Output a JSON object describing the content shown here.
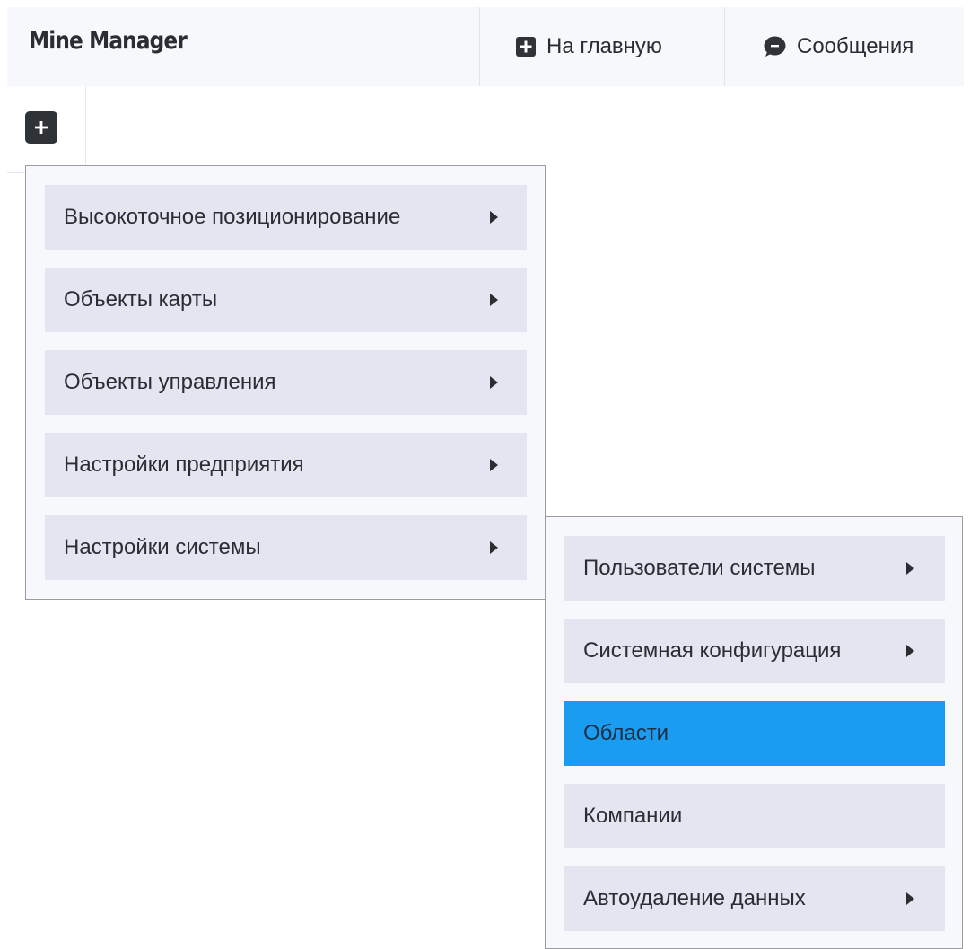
{
  "header": {
    "app_title": "Mine Manager",
    "nav": {
      "home_label": "На главную",
      "messages_label": "Сообщения"
    }
  },
  "sidebar": {
    "add_button_icon": "plus-square-icon"
  },
  "menu": {
    "items": [
      {
        "label": "Высокоточное позиционирование",
        "has_submenu": true
      },
      {
        "label": "Объекты карты",
        "has_submenu": true
      },
      {
        "label": "Объекты управления",
        "has_submenu": true
      },
      {
        "label": "Настройки предприятия",
        "has_submenu": true
      },
      {
        "label": "Настройки системы",
        "has_submenu": true,
        "expanded": true
      }
    ]
  },
  "submenu": {
    "items": [
      {
        "label": "Пользователи системы",
        "has_submenu": true
      },
      {
        "label": "Системная конфигурация",
        "has_submenu": true
      },
      {
        "label": "Области",
        "has_submenu": false,
        "highlighted": true
      },
      {
        "label": "Компании",
        "has_submenu": false
      },
      {
        "label": "Автоудаление данных",
        "has_submenu": true
      }
    ]
  },
  "colors": {
    "header_bg": "#f7f8fb",
    "menu_item_bg": "#e4e5f0",
    "highlight": "#1a9cf0",
    "dark_icon": "#2f3237"
  }
}
